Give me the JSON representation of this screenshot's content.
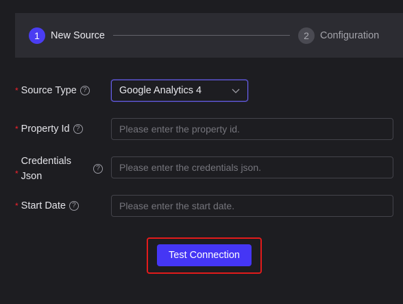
{
  "steps": [
    {
      "number": "1",
      "label": "New Source",
      "state": "active"
    },
    {
      "number": "2",
      "label": "Configuration",
      "state": "inactive"
    }
  ],
  "form": {
    "source_type": {
      "label": "Source Type",
      "required": "*",
      "value": "Google Analytics 4",
      "icon": "chevron-down-icon"
    },
    "property_id": {
      "label": "Property Id",
      "required": "*",
      "placeholder": "Please enter the property id."
    },
    "credentials_json": {
      "label_line1": "Credentials",
      "label_line2": "Json",
      "required": "*",
      "placeholder": "Please enter the credentials json."
    },
    "start_date": {
      "label": "Start Date",
      "required": "*",
      "placeholder": "Please enter the start date."
    },
    "help_glyph": "?"
  },
  "actions": {
    "test_connection_label": "Test Connection"
  },
  "colors": {
    "accent": "#4536f5",
    "required": "#f5222d",
    "highlight": "#e41b1b",
    "background": "#1d1d21",
    "panel": "#2c2c32"
  }
}
